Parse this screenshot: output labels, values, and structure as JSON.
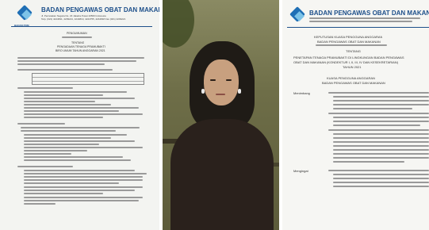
{
  "left_doc": {
    "org_name": "BADAN PENGAWAS OBAT DAN MAKANAN",
    "org_address": "Jl. Percetakan Negara No. 23 Jakarta Pusat 10560 Indonesia",
    "org_contact": "Telp. (021) 4244691, 4209221, 4244819, 4244755, 4244818 Fax (021) 4209221",
    "logo_label": "BADAN POM",
    "heading": "PENGUMUMAN",
    "subheading": "TENTANG",
    "title_line1": "PENGADAAN TENAGA PRAMUBAKTI",
    "title_line2": "BIRO UMUM TAHUN ANGGARAN 2021"
  },
  "right_doc": {
    "org_name": "BADAN PENGAWAS OBAT DAN MAKANAN",
    "decree_title": "KEPUTUSAN KUASA PENGGUNA ANGGARAN",
    "decree_org": "BADAN PENGAWAS OBAT DAN MAKANAN",
    "decree_line3": "TENTANG",
    "decree_subject1": "PENETAPAN TENAGA PRAMUBAKTI DI LINGKUNGAN BADAN PENGAWAS",
    "decree_subject2": "OBAT DAN MAKANAN (KONDEKTUR I, II, III, IV DAN KESEKRETARIAN)",
    "decree_year": "TAHUN 2021",
    "kuasa_label": "KUASA PENGGUNA ANGGARAN",
    "kuasa_org": "BADAN PENGAWAS OBAT DAN MAKANAN",
    "menimbang_label": "Menimbang",
    "mengingat_label": "Mengingat"
  },
  "colors": {
    "brand_blue": "#1d4f8a",
    "logo_light_blue": "#7cc3e8"
  }
}
